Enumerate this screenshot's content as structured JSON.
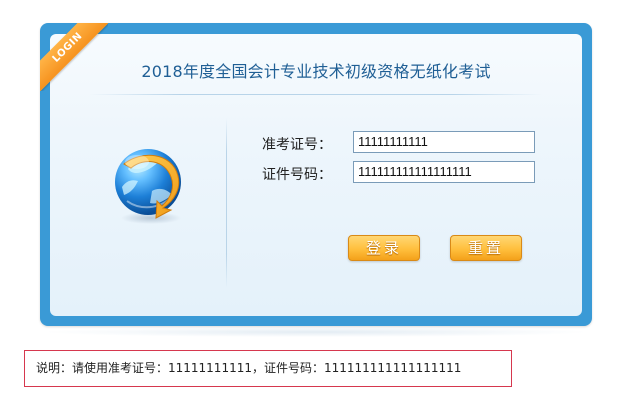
{
  "title": "2018年度全国会计专业技术初级资格无纸化考试",
  "ribbon": "LOGIN",
  "form": {
    "ticket_label": "准考证号：",
    "ticket_value": "11111111111",
    "id_label": "证件号码：",
    "id_value": "111111111111111111"
  },
  "buttons": {
    "login": "登录",
    "reset": "重置"
  },
  "note": "说明：请使用准考证号：11111111111，证件号码：111111111111111111",
  "icons": {
    "globe": "globe-icon",
    "ribbon": "login-ribbon"
  },
  "colors": {
    "frame": "#3a9ad6",
    "title": "#1f5f95",
    "button": "#ffbf3d",
    "note_border": "#d6374e"
  }
}
